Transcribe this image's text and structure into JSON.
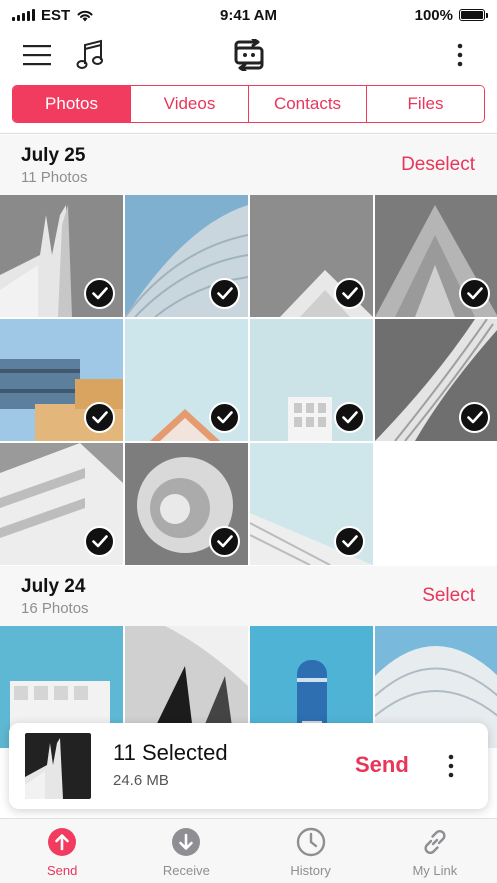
{
  "status_bar": {
    "carrier": "EST",
    "time": "9:41 AM",
    "battery_percent": "100%",
    "battery_level": 1.0
  },
  "toolbar": {
    "icons": [
      "menu-icon",
      "music-note-icon",
      "sync-icon",
      "more-vertical-icon"
    ]
  },
  "tabs": [
    {
      "label": "Photos",
      "active": true
    },
    {
      "label": "Videos",
      "active": false
    },
    {
      "label": "Contacts",
      "active": false
    },
    {
      "label": "Files",
      "active": false
    }
  ],
  "sections": [
    {
      "date": "July 25",
      "count": "11 Photos",
      "action": "Deselect",
      "photos_shown": 11,
      "all_selected": true
    },
    {
      "date": "July 24",
      "count": "16 Photos",
      "action": "Select",
      "photos_shown": 4,
      "all_selected": false
    }
  ],
  "selection_bar": {
    "title": "11 Selected",
    "size": "24.6 MB",
    "send_label": "Send"
  },
  "tabbar": [
    {
      "label": "Send",
      "icon": "arrow-up-circle-icon",
      "active": true
    },
    {
      "label": "Receive",
      "icon": "arrow-down-circle-icon",
      "active": false
    },
    {
      "label": "History",
      "icon": "clock-icon",
      "active": false
    },
    {
      "label": "My Link",
      "icon": "link-icon",
      "active": false
    }
  ],
  "colors": {
    "accent": "#f23c5f",
    "accent_text": "#e8365a",
    "muted": "#8e8e93"
  }
}
